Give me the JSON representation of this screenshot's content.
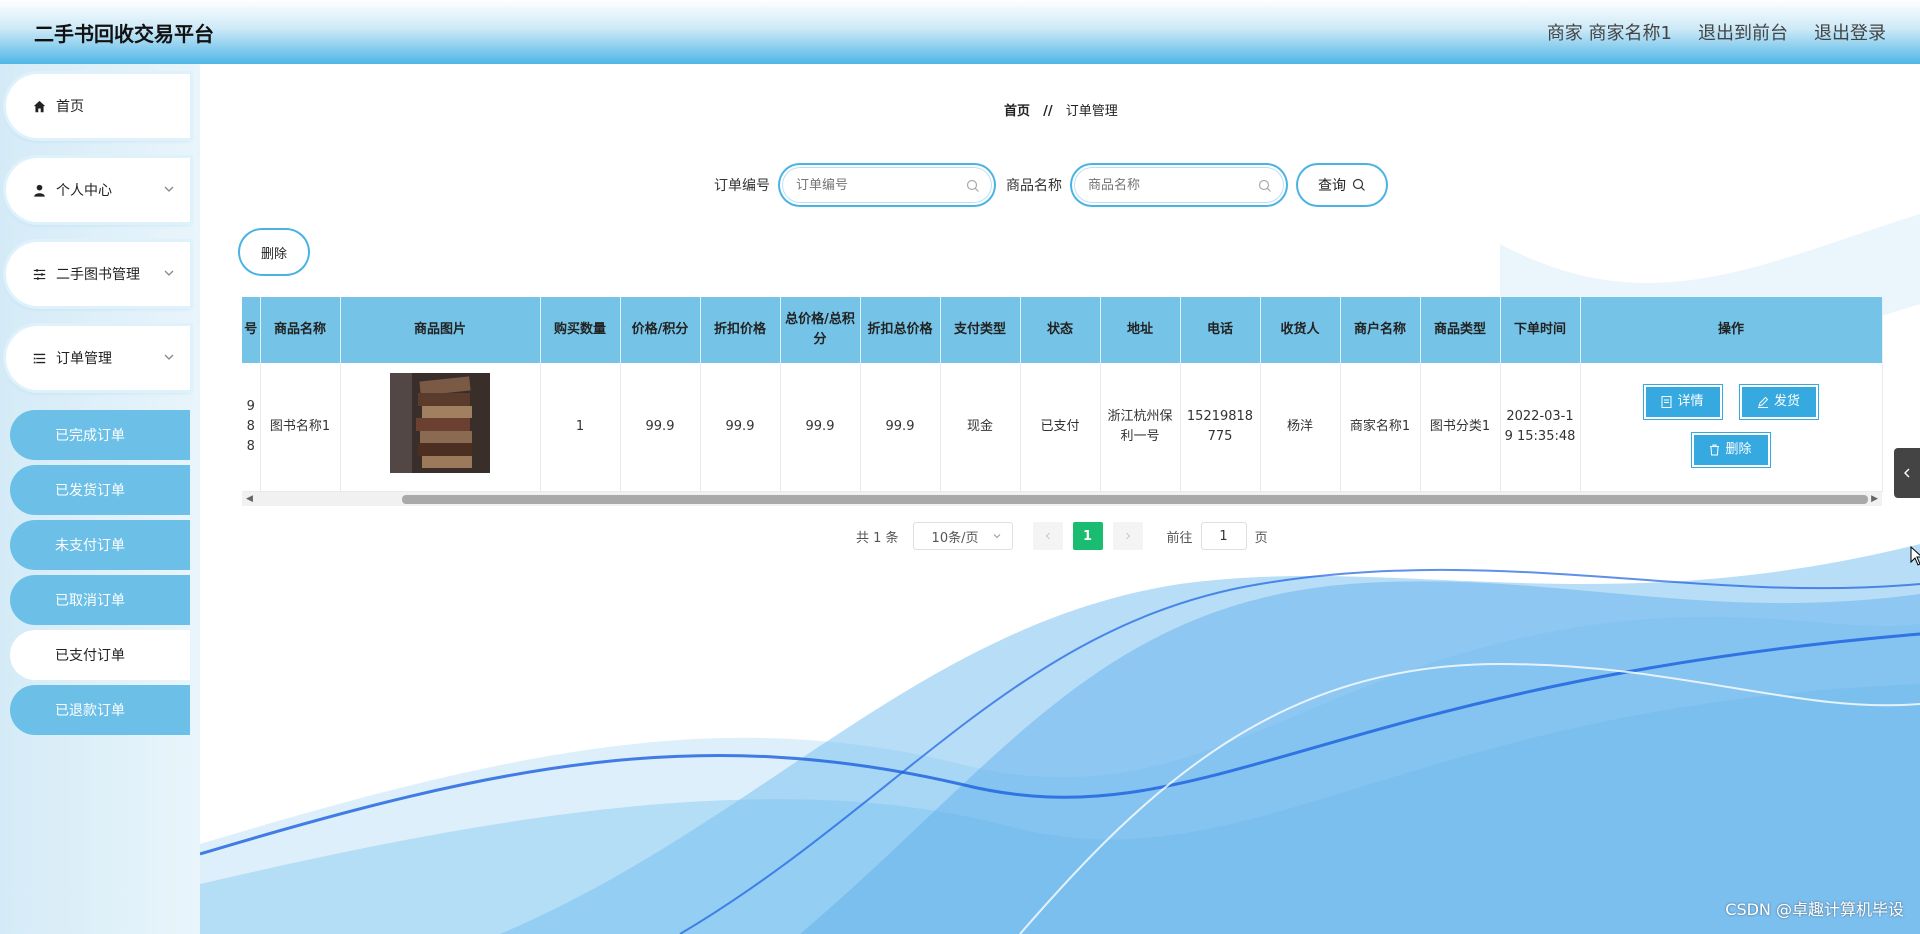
{
  "header": {
    "title": "二手书回收交易平台",
    "user": "商家 商家名称1",
    "back_front": "退出到前台",
    "logout": "退出登录"
  },
  "sidebar": {
    "items": [
      {
        "label": "首页",
        "icon": "home-icon"
      },
      {
        "label": "个人中心",
        "icon": "user-icon"
      },
      {
        "label": "二手图书管理",
        "icon": "sliders-icon"
      },
      {
        "label": "订单管理",
        "icon": "list-icon"
      }
    ],
    "sub_items": [
      "已完成订单",
      "已发货订单",
      "未支付订单",
      "已取消订单",
      "已支付订单",
      "已退款订单"
    ],
    "active_sub": "已支付订单"
  },
  "breadcrumb": {
    "home": "首页",
    "sep": "//",
    "current": "订单管理"
  },
  "search": {
    "order_no_label": "订单编号",
    "order_no_placeholder": "订单编号",
    "product_label": "商品名称",
    "product_placeholder": "商品名称",
    "query_label": "查询"
  },
  "toolbar": {
    "delete_label": "删除"
  },
  "table": {
    "columns": [
      "号",
      "商品名称",
      "商品图片",
      "购买数量",
      "价格/积分",
      "折扣价格",
      "总价格/总积分",
      "折扣总价格",
      "支付类型",
      "状态",
      "地址",
      "电话",
      "收货人",
      "商户名称",
      "商品类型",
      "下单时间",
      "操作"
    ],
    "rows": [
      {
        "order_no": "9 8 8",
        "product_name": "图书名称1",
        "qty": "1",
        "price": "99.9",
        "discount_price": "99.9",
        "total_price": "99.9",
        "discount_total": "99.9",
        "pay_type": "现金",
        "status": "已支付",
        "address": "浙江杭州保利一号",
        "phone": "15219818775",
        "receiver": "杨洋",
        "merchant": "商家名称1",
        "category": "图书分类1",
        "order_time": "2022-03-19 15:35:48"
      }
    ],
    "actions": {
      "detail": "详情",
      "ship": "发货",
      "delete": "删除"
    }
  },
  "pagination": {
    "total": "共 1 条",
    "page_size": "10条/页",
    "current": "1",
    "goto_prefix": "前往",
    "goto_value": "1",
    "goto_suffix": "页"
  },
  "watermark": "CSDN @卓趣计算机毕设",
  "colors": {
    "accent": "#36a9e1",
    "header_bottom": "#4fb6e6",
    "table_header": "#75c4e8",
    "pager_active": "#1abc6f"
  }
}
